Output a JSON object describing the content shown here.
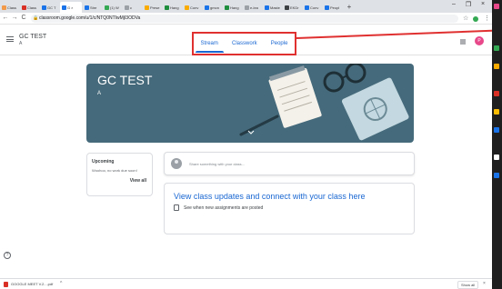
{
  "browser": {
    "tabs": [
      {
        "label": "Class",
        "color": "#f2994a"
      },
      {
        "label": "Class",
        "color": "#d93025"
      },
      {
        "label": "GC T",
        "color": "#1a73e8"
      },
      {
        "label": "G",
        "color": "#1a73e8",
        "active": true
      },
      {
        "label": "Stre",
        "color": "#1a73e8"
      },
      {
        "label": "(1) W",
        "color": "#34a853"
      },
      {
        "label": "c",
        "color": "#9aa0a6"
      },
      {
        "label": "Prese",
        "color": "#f9ab00"
      },
      {
        "label": "Hang",
        "color": "#1e8e3e"
      },
      {
        "label": "Conv",
        "color": "#f9ab00"
      },
      {
        "label": "gmon",
        "color": "#1a73e8"
      },
      {
        "label": "Hang",
        "color": "#1e8e3e"
      },
      {
        "label": "e-lea",
        "color": "#9aa0a6"
      },
      {
        "label": "Maste",
        "color": "#1a73e8"
      },
      {
        "label": "EKDr",
        "color": "#3c4043"
      },
      {
        "label": "Conv",
        "color": "#1a73e8"
      },
      {
        "label": "Peopl",
        "color": "#1a73e8"
      }
    ],
    "tab_close_glyph": "×",
    "new_tab_glyph": "+",
    "window_minimize": "–",
    "window_maximize": "❐",
    "window_close": "×",
    "back_glyph": "←",
    "forward_glyph": "→",
    "reload_glyph": "C",
    "url": "classroom.google.com/u/1/c/NTQ0NTIwMjI3ODVa",
    "star_glyph": "☆",
    "more_glyph": "⋮"
  },
  "classroom": {
    "class_name": "GC TEST",
    "section": "A",
    "nav_tabs": [
      "Stream",
      "Classwork",
      "People"
    ],
    "active_tab": "Stream",
    "avatar_initial": "P",
    "banner_title": "GC TEST",
    "banner_section": "A",
    "upcoming_title": "Upcoming",
    "upcoming_text": "Woohoo, no work due soon!",
    "view_all": "View all",
    "share_placeholder": "Share something with your class...",
    "updates_title": "View class updates and connect with your class here",
    "updates_sub": "See when new assignments are posted"
  },
  "download": {
    "file_name": "GOOGLE MEET V.2....pdf",
    "chevron": "^",
    "show_all": "Show all",
    "close": "×"
  },
  "help_glyph": "?",
  "colors": {
    "accent": "#1967d2",
    "banner": "#456a7b",
    "annotation": "#e03030"
  }
}
